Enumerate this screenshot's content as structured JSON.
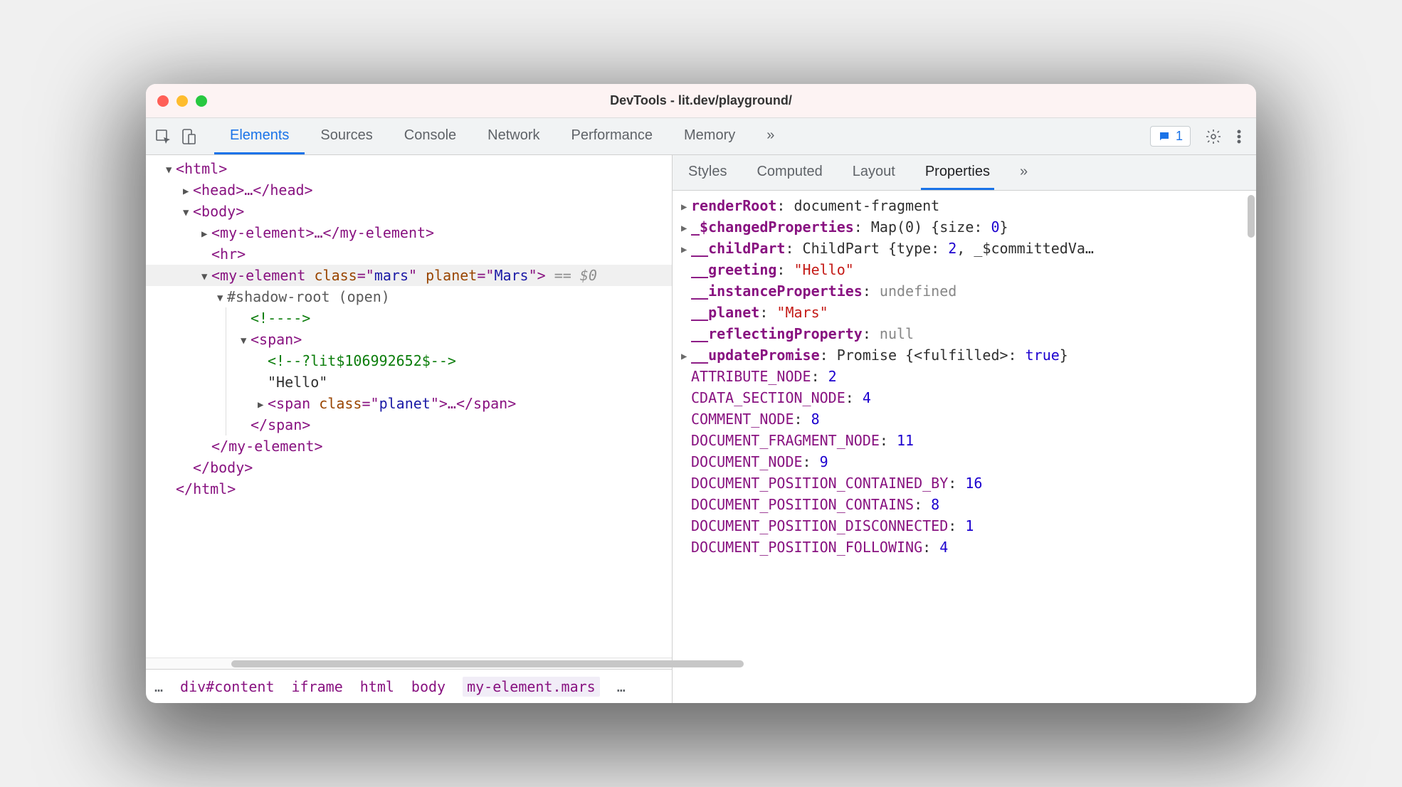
{
  "title": "DevTools - lit.dev/playground/",
  "issues_count": "1",
  "main_tabs": [
    "Elements",
    "Sources",
    "Console",
    "Network",
    "Performance",
    "Memory",
    "»"
  ],
  "main_active_index": 0,
  "sub_tabs": [
    "Styles",
    "Computed",
    "Layout",
    "Properties",
    "»"
  ],
  "sub_active_index": 3,
  "breadcrumbs": [
    "…",
    "div#content",
    "iframe",
    "html",
    "body",
    "my-element.mars",
    "…"
  ],
  "breadcrumb_selected_index": 5,
  "dom": {
    "html_open": "<html>",
    "head": "<head>…</head>",
    "body_open": "<body>",
    "my1": "<my-element>…</my-element>",
    "hr": "<hr>",
    "my2_open_pre": "<",
    "my2_tag": "my-element",
    "my2_attr1_n": "class",
    "my2_attr1_v": "mars",
    "my2_attr2_n": "planet",
    "my2_attr2_v": "Mars",
    "my2_close_punct": ">",
    "my2_hint": " == $0",
    "shadow": "#shadow-root (open)",
    "cmt1": "<!---->",
    "span_open": "<span>",
    "cmt2": "<!--?lit$106992652$-->",
    "text_hello": "\"Hello\"",
    "span_planet_pre": "<",
    "span_planet_tag": "span",
    "span_planet_attr_n": "class",
    "span_planet_attr_v": "planet",
    "span_planet_mid": ">…</",
    "span_planet_end": ">",
    "span_close": "</span>",
    "my2_close": "</my-element>",
    "body_close": "</body>",
    "html_close": "</html>"
  },
  "props": [
    {
      "tw": "▶",
      "name": "renderRoot",
      "bold": true,
      "val": "document-fragment",
      "kind": "obj"
    },
    {
      "tw": "▶",
      "name": "_$changedProperties",
      "bold": true,
      "val": "Map(0) {size: 0}",
      "kind": "obj-num",
      "num": "0"
    },
    {
      "tw": "▶",
      "name": "__childPart",
      "bold": true,
      "val": "ChildPart {type: 2, _$committedVa…",
      "kind": "obj-num2",
      "num": "2"
    },
    {
      "tw": "",
      "name": "__greeting",
      "bold": true,
      "val": "\"Hello\"",
      "kind": "str"
    },
    {
      "tw": "",
      "name": "__instanceProperties",
      "bold": true,
      "val": "undefined",
      "kind": "kw"
    },
    {
      "tw": "",
      "name": "__planet",
      "bold": true,
      "val": "\"Mars\"",
      "kind": "str"
    },
    {
      "tw": "",
      "name": "__reflectingProperty",
      "bold": true,
      "val": "null",
      "kind": "kw"
    },
    {
      "tw": "▶",
      "name": "__updatePromise",
      "bold": true,
      "val": "Promise {<fulfilled>: true}",
      "kind": "obj-bool",
      "bool": "true"
    },
    {
      "tw": "",
      "name": "ATTRIBUTE_NODE",
      "bold": false,
      "val": "2",
      "kind": "num"
    },
    {
      "tw": "",
      "name": "CDATA_SECTION_NODE",
      "bold": false,
      "val": "4",
      "kind": "num"
    },
    {
      "tw": "",
      "name": "COMMENT_NODE",
      "bold": false,
      "val": "8",
      "kind": "num"
    },
    {
      "tw": "",
      "name": "DOCUMENT_FRAGMENT_NODE",
      "bold": false,
      "val": "11",
      "kind": "num"
    },
    {
      "tw": "",
      "name": "DOCUMENT_NODE",
      "bold": false,
      "val": "9",
      "kind": "num"
    },
    {
      "tw": "",
      "name": "DOCUMENT_POSITION_CONTAINED_BY",
      "bold": false,
      "val": "16",
      "kind": "num"
    },
    {
      "tw": "",
      "name": "DOCUMENT_POSITION_CONTAINS",
      "bold": false,
      "val": "8",
      "kind": "num"
    },
    {
      "tw": "",
      "name": "DOCUMENT_POSITION_DISCONNECTED",
      "bold": false,
      "val": "1",
      "kind": "num"
    },
    {
      "tw": "",
      "name": "DOCUMENT_POSITION_FOLLOWING",
      "bold": false,
      "val": "4",
      "kind": "num"
    }
  ]
}
